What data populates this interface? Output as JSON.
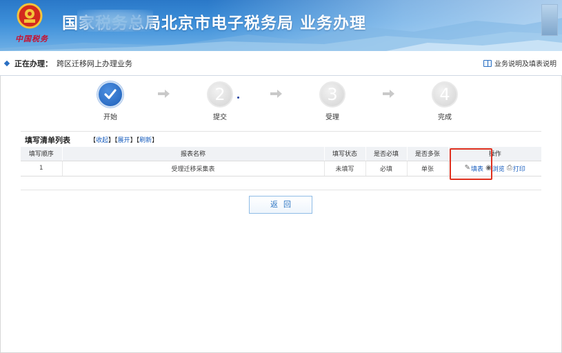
{
  "banner": {
    "title": "国家税务总局北京市电子税务局 业务办理",
    "emblem_text": "中国税务"
  },
  "status": {
    "label": "正在办理：",
    "value": "跨区迁移网上办理业务",
    "help": "业务说明及填表说明"
  },
  "steps": [
    {
      "num": "✓",
      "label": "开始",
      "state": "done"
    },
    {
      "num": "2",
      "label": "提交",
      "state": "todo"
    },
    {
      "num": "3",
      "label": "受理",
      "state": "todo"
    },
    {
      "num": "4",
      "label": "完成",
      "state": "todo"
    }
  ],
  "list": {
    "title": "填写清单列表",
    "link_collapse": "收起",
    "link_expand": "展开",
    "link_refresh": "刷新",
    "headers": [
      "填写顺序",
      "报表名称",
      "填写状态",
      "是否必填",
      "是否多张",
      "操作"
    ],
    "rows": [
      {
        "order": "1",
        "name": "受理迁移采集表",
        "status": "未填写",
        "required": "必填",
        "multi": "单张",
        "op_fill": "填表",
        "op_browse": "浏览",
        "op_print": "打印"
      }
    ]
  },
  "buttons": {
    "back": "返回"
  },
  "colors": {
    "accent": "#1a5fbf",
    "highlight": "#e0301e",
    "banner": "#3d8fd9"
  }
}
